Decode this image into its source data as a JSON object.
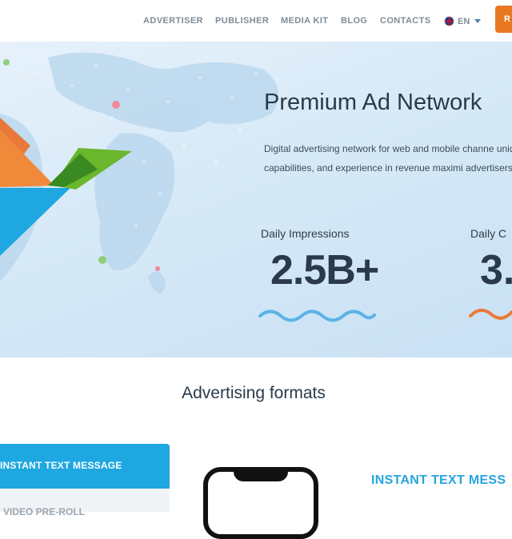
{
  "nav": {
    "items": [
      "ADVERTISER",
      "PUBLISHER",
      "MEDIA KIT",
      "BLOG",
      "CONTACTS"
    ],
    "language": "EN",
    "cta_partial": "R"
  },
  "hero": {
    "title": "Premium Ad Network",
    "description": "Digital advertising network for web and mobile channe unique capabilities, and experience in revenue maximi advertisers.",
    "stats": [
      {
        "label": "Daily Impressions",
        "value": "2.5B+",
        "wave_color": "#5bb3e6"
      },
      {
        "label": "Daily C",
        "value": "3.",
        "wave_color": "#e8793a"
      }
    ]
  },
  "formats": {
    "title": "Advertising formats",
    "tabs": [
      "INSTANT TEXT MESSAGE",
      "VIDEO PRE-ROLL"
    ],
    "active_heading": "INSTANT TEXT MESS"
  },
  "colors": {
    "accent_blue": "#1ea7e1",
    "accent_orange": "#e87722"
  }
}
